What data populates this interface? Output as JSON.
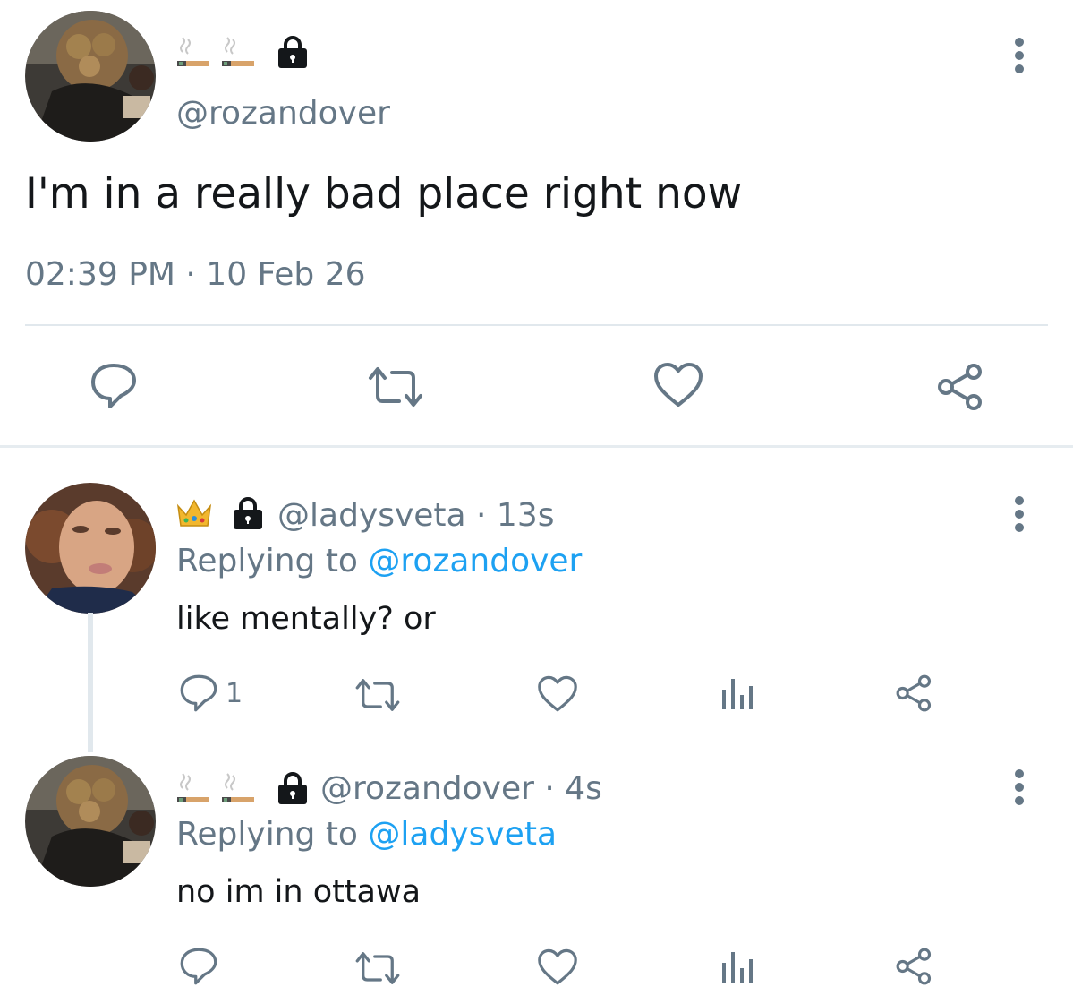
{
  "main_tweet": {
    "display_name_emoji": [
      "cigarette",
      "cigarette",
      "lock"
    ],
    "handle": "@rozandover",
    "text": "I'm in a really bad place right now",
    "timestamp": "02:39 PM · 10 Feb 26",
    "actions": [
      "reply-icon",
      "retweet-icon",
      "like-icon",
      "share-icon"
    ]
  },
  "replies": [
    {
      "name_emoji": [
        "crown",
        "lock"
      ],
      "handle_time": "@ladysveta · 13s",
      "replying_prefix": "Replying to ",
      "replying_to": "@rozandover",
      "text": "like mentally? or",
      "reply_count": "1"
    },
    {
      "name_emoji": [
        "cigarette",
        "cigarette",
        "lock"
      ],
      "handle_time": "@rozandover · 4s",
      "replying_prefix": "Replying to ",
      "replying_to": "@ladysveta",
      "text": "no im in ottawa",
      "reply_count": ""
    }
  ],
  "colors": {
    "text_primary": "#14171a",
    "text_secondary": "#657786",
    "link": "#1da1f2",
    "divider": "#e1e8ed"
  }
}
